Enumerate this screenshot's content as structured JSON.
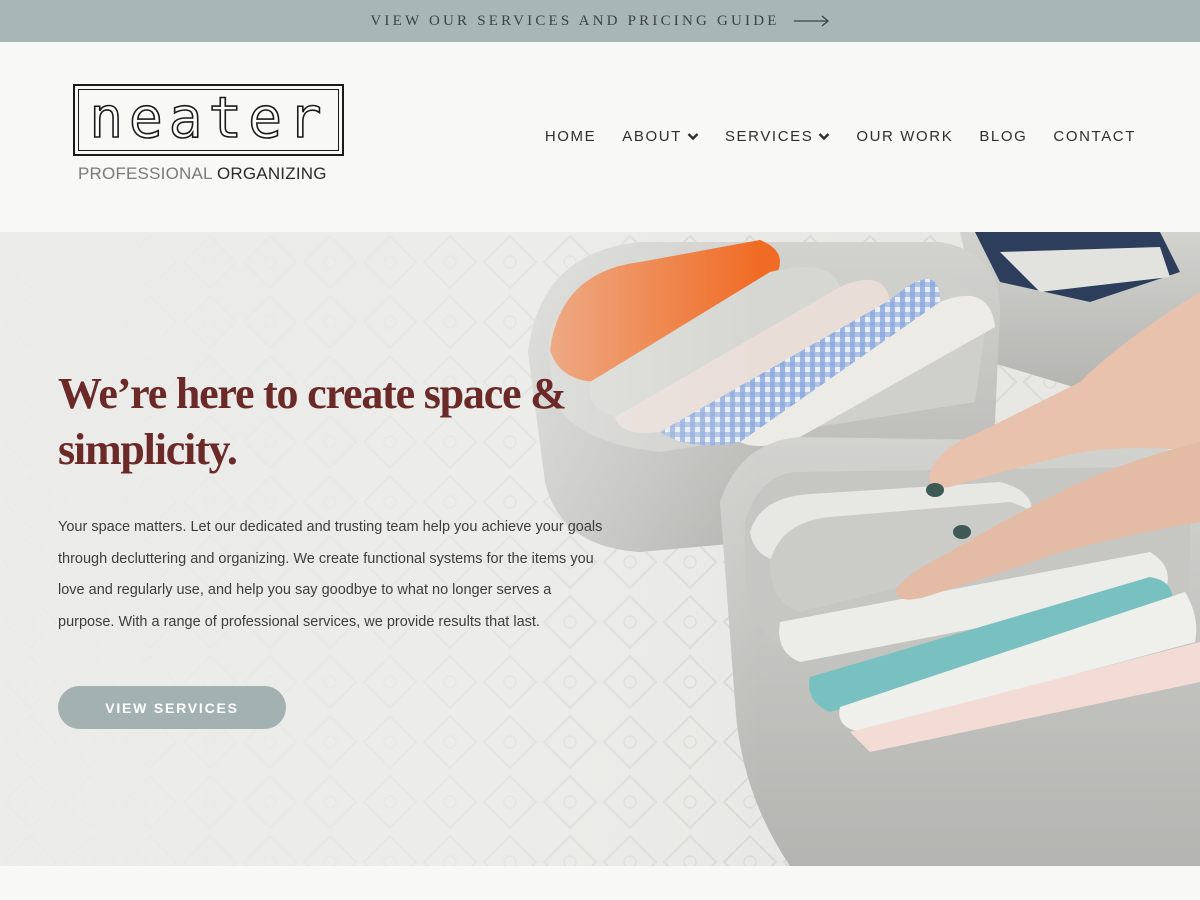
{
  "banner": {
    "text": "View our services and pricing guide",
    "icon": "arrow-right-icon"
  },
  "logo": {
    "wordmark": "neater",
    "tagline_light": "PROFESSIONAL",
    "tagline_dark": "ORGANIZING"
  },
  "nav": {
    "items": [
      {
        "label": "HOME",
        "dropdown": false
      },
      {
        "label": "ABOUT",
        "dropdown": true
      },
      {
        "label": "SERVICES",
        "dropdown": true
      },
      {
        "label": "OUR WORK",
        "dropdown": false
      },
      {
        "label": "BLOG",
        "dropdown": false
      },
      {
        "label": "CONTACT",
        "dropdown": false
      }
    ],
    "dropdown_icon": "chevron-down-icon"
  },
  "hero": {
    "title": "We’re here to create space & simplicity.",
    "body": "Your space matters. Let our dedicated and trusting team help you achieve your goals through decluttering and organizing. We create functional systems for the items you love and regularly use, and help you say goodbye to what no longer serves a purpose. With a range of professional services, we provide results that last.",
    "button_label": "VIEW SERVICES"
  },
  "colors": {
    "banner_bg": "#a8b7b5",
    "title": "#6b2a27",
    "button_bg": "#a3b2b0",
    "page_bg": "#f8f8f7"
  }
}
